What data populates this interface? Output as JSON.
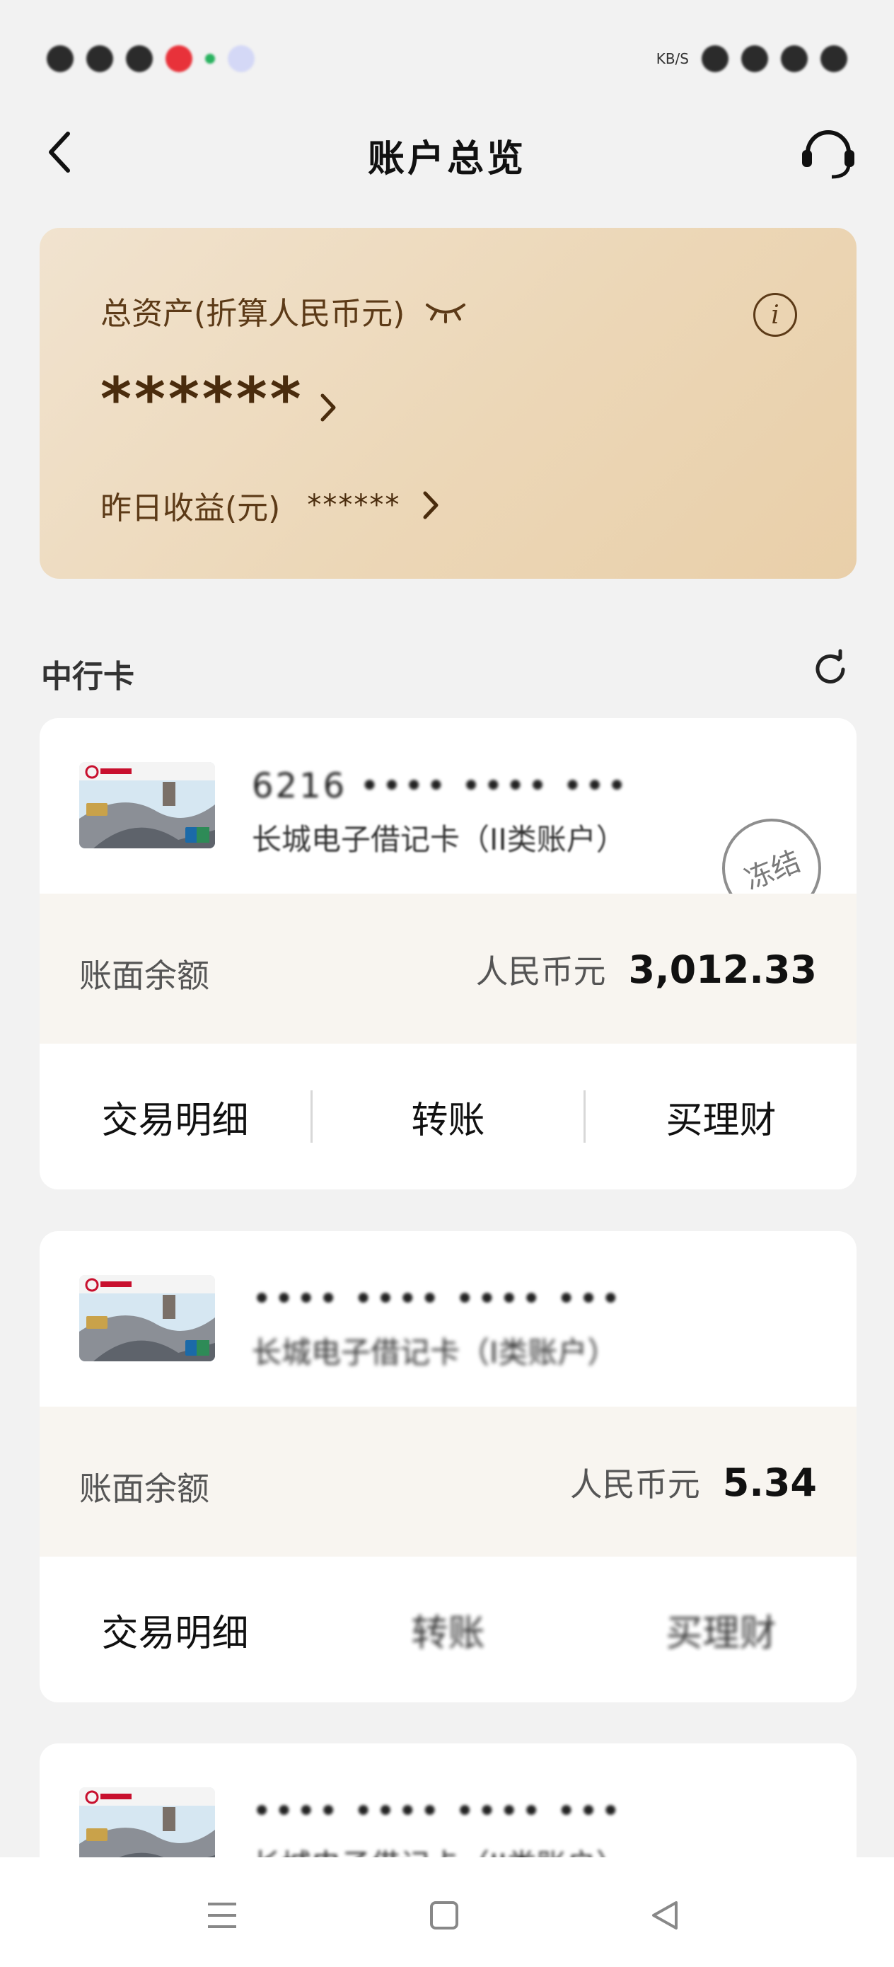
{
  "status_bar": {
    "net_speed_unit": "KB/S"
  },
  "nav": {
    "title": "账户总览"
  },
  "asset_card": {
    "label": "总资产(折算人民币元)",
    "value_masked": "******",
    "yesterday_label": "昨日收益(元)",
    "yesterday_masked": "******",
    "info_symbol": "i"
  },
  "section": {
    "title": "中行卡"
  },
  "accounts": [
    {
      "card_number": "6216 •••• •••• •••",
      "card_type": "长城电子借记卡（II类账户）",
      "status_stamp": "冻结",
      "balance_label": "账面余额",
      "currency": "人民币元",
      "amount": "3,012.33",
      "actions": [
        "交易明细",
        "转账",
        "买理财"
      ]
    },
    {
      "card_number": "•••• •••• •••• •••",
      "card_type": "长城电子借记卡（I类账户）",
      "balance_label": "账面余额",
      "currency": "人民币元",
      "amount": "5.34",
      "actions": [
        "交易明细",
        "转账",
        "买理财"
      ]
    },
    {
      "card_number": "•••• •••• •••• •••",
      "card_type": "长城电子借记卡（II类账户）"
    }
  ],
  "colors": {
    "asset_card_start": "#f1e3cf",
    "asset_card_end": "#e9cfa9",
    "asset_text": "#5c3a17",
    "balance_bg": "#f8f5f0",
    "page_bg": "#f2f2f2"
  }
}
